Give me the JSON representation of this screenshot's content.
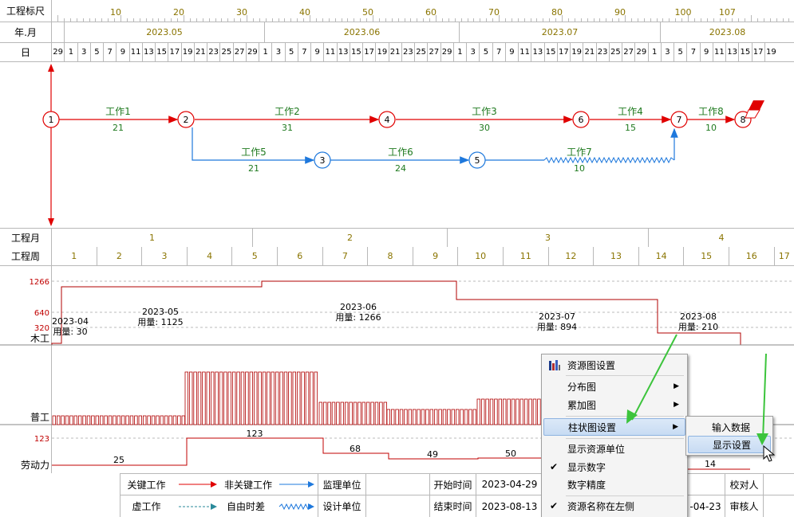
{
  "header": {
    "scale_label": "工程标尺",
    "month_label": "年.月",
    "day_label": "日",
    "scale_ticks": [
      "10",
      "20",
      "30",
      "40",
      "50",
      "60",
      "70",
      "80",
      "90",
      "100",
      "107"
    ],
    "months": [
      "2023.05",
      "2023.06",
      "2023.07",
      "2023.08"
    ],
    "days": [
      "29",
      "1",
      "3",
      "5",
      "7",
      "9",
      "11",
      "13",
      "15",
      "17",
      "19",
      "21",
      "23",
      "25",
      "27",
      "29",
      "1",
      "3",
      "5",
      "7",
      "9",
      "11",
      "13",
      "15",
      "17",
      "19",
      "21",
      "23",
      "25",
      "27",
      "29",
      "1",
      "3",
      "5",
      "7",
      "9",
      "11",
      "13",
      "15",
      "17",
      "19",
      "21",
      "23",
      "25",
      "27",
      "29",
      "1",
      "3",
      "5",
      "7",
      "9",
      "11",
      "13",
      "15",
      "17",
      "19"
    ]
  },
  "network": {
    "nodes": [
      "1",
      "2",
      "3",
      "4",
      "5",
      "6",
      "7",
      "8"
    ],
    "works": [
      {
        "name": "工作1",
        "duration": "21"
      },
      {
        "name": "工作2",
        "duration": "31"
      },
      {
        "name": "工作3",
        "duration": "30"
      },
      {
        "name": "工作4",
        "duration": "15"
      },
      {
        "name": "工作8",
        "duration": "10"
      },
      {
        "name": "工作5",
        "duration": "21"
      },
      {
        "name": "工作6",
        "duration": "24"
      },
      {
        "name": "工作7",
        "duration": "10"
      }
    ]
  },
  "project_month": {
    "label": "工程月",
    "values": [
      "1",
      "2",
      "3",
      "4"
    ]
  },
  "project_week": {
    "label": "工程周",
    "values": [
      "1",
      "2",
      "3",
      "4",
      "5",
      "6",
      "7",
      "8",
      "9",
      "10",
      "11",
      "12",
      "13",
      "14",
      "15",
      "16",
      "17"
    ]
  },
  "resources": {
    "carpenter": {
      "name": "木工",
      "axis": [
        "1266",
        "640",
        "320"
      ],
      "blocks": [
        {
          "month": "2023-04",
          "usage": "用量: 30"
        },
        {
          "month": "2023-05",
          "usage": "用量: 1125"
        },
        {
          "month": "2023-06",
          "usage": "用量: 1266"
        },
        {
          "month": "2023-07",
          "usage": "用量: 894"
        },
        {
          "month": "2023-08",
          "usage": "用量: 210"
        }
      ]
    },
    "laborer": {
      "name": "普工"
    },
    "labor_force": {
      "name": "劳动力",
      "axis": "123",
      "values": [
        "25",
        "123",
        "68",
        "49",
        "50",
        "14"
      ]
    }
  },
  "legend": {
    "critical": "关键工作",
    "noncritical": "非关键工作",
    "supervision": "监理单位",
    "start_label": "开始时间",
    "start_value": "2023-04-29",
    "checker": "校对人",
    "virtual": "虚工作",
    "free_float": "自由时差",
    "design": "设计单位",
    "end_label": "结束时间",
    "end_value": "2023-08-13",
    "date_partial": "-04-23",
    "reviewer": "审核人"
  },
  "context_menu": {
    "items": [
      {
        "label": "资源图设置",
        "icon": "bar-chart-icon"
      },
      {
        "label": "分布图",
        "submenu": true
      },
      {
        "label": "累加图",
        "submenu": true
      },
      {
        "label": "柱状图设置",
        "submenu": true,
        "highlighted": true
      },
      {
        "label": "显示资源单位"
      },
      {
        "label": "显示数字",
        "checked": true
      },
      {
        "label": "数字精度"
      },
      {
        "label": "资源名称在左侧",
        "checked": true
      }
    ],
    "check_glyph": "✔",
    "arrow_glyph": "▶"
  },
  "submenu": {
    "items": [
      {
        "label": "输入数据"
      },
      {
        "label": "显示设置",
        "highlighted": true
      }
    ]
  },
  "colors": {
    "critical": "#e00000",
    "noncritical": "#1e78dc",
    "label_green": "#1f7a1f",
    "olive": "#8a7400",
    "annotation_arrow": "#3cc43c"
  }
}
